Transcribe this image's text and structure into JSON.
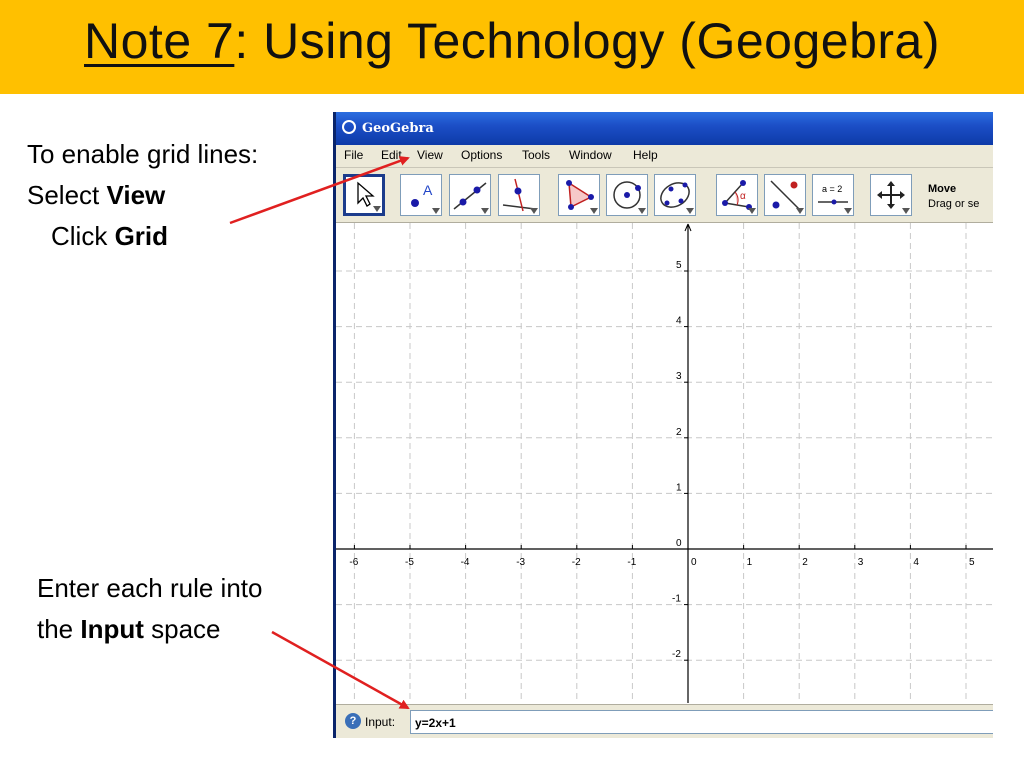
{
  "slide": {
    "title_underlined": "Note 7",
    "title_rest": ":  Using Technology (Geogebra)",
    "note_grid": {
      "line1": "To enable grid lines:",
      "line2_prefix": "Select ",
      "line2_bold": "View",
      "line3_prefix": "Click ",
      "line3_bold": "Grid"
    },
    "note_input": {
      "line1": "Enter each rule into",
      "line2_prefix": "the ",
      "line2_bold": "Input",
      "line2_suffix": " space"
    },
    "colors": {
      "title_bar": "#ffc000",
      "arrow": "#e02020"
    }
  },
  "geogebra": {
    "window_title": "GeoGebra",
    "menu": [
      "File",
      "Edit",
      "View",
      "Options",
      "Tools",
      "Window",
      "Help"
    ],
    "toolbar_tools": [
      {
        "icon": "move-cursor-icon",
        "selected": true
      },
      {
        "icon": "new-point-icon",
        "label": "A"
      },
      {
        "icon": "line-through-two-points-icon"
      },
      {
        "icon": "perpendicular-line-icon"
      },
      {
        "icon": "polygon-icon"
      },
      {
        "icon": "circle-center-point-icon"
      },
      {
        "icon": "conic-five-points-icon"
      },
      {
        "icon": "angle-icon",
        "label": "α"
      },
      {
        "icon": "reflect-about-line-icon"
      },
      {
        "icon": "slider-icon",
        "label": "a = 2"
      },
      {
        "icon": "move-graphics-view-icon"
      }
    ],
    "tool_help": {
      "name": "Move",
      "description": "Drag or se"
    },
    "graph": {
      "x_ticks": [
        "-6",
        "-5",
        "-4",
        "-3",
        "-2",
        "-1",
        "0",
        "1",
        "2",
        "3",
        "4",
        "5"
      ],
      "y_ticks": [
        "5",
        "4",
        "3",
        "2",
        "1",
        "0",
        "-1",
        "-2"
      ],
      "grid": true
    },
    "input": {
      "label": "Input:",
      "value": "y=2x+1",
      "help_glyph": "?"
    }
  }
}
